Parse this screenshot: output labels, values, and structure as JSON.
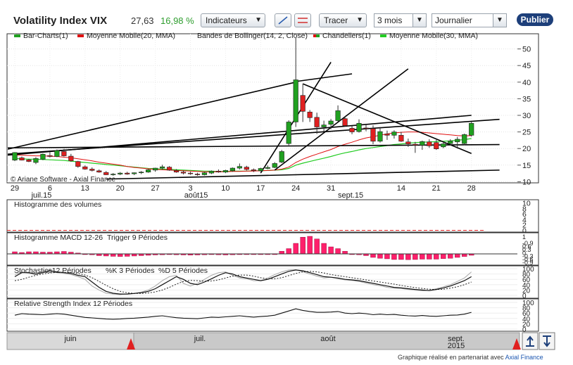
{
  "toolbar": {
    "title": "Volatility Index VIX",
    "price": "27,63",
    "change": "16,98 %",
    "indicators_label": "Indicateurs",
    "draw_label": "Tracer",
    "period_value": "3 mois",
    "frequency_value": "Journalier",
    "publish_label": "Publier",
    "dropdown_icon": "chevron-down-icon",
    "line_tool_icon": "diagonal-line-icon",
    "hline_tool_icon": "horizontal-lines-icon"
  },
  "footer": {
    "text": "Graphique réalisé en partenariat avec",
    "link": "Axial Finance"
  },
  "colors": {
    "up": "#20a020",
    "down": "#e02020",
    "ma20": "#e01010",
    "ma30": "#22cc22",
    "histogram": "#ff1f6b",
    "trend": "#000000",
    "navigator": "#d9d9d9",
    "accent": "#1d3f7a"
  },
  "chart_data": [
    {
      "type": "candlestick",
      "legend": [
        "Bar-Charts(1)",
        "Moyenne Mobile(20, MMA)",
        "Bandes de Bollinger(14, 2, Close)",
        "Chandeliers(1)",
        "Moyenne Mobile(30, MMA)"
      ],
      "watermark": "© Ariane Software - Axial Finance",
      "x_ticks": [
        {
          "label": "29",
          "i": 0
        },
        {
          "label": "6",
          "i": 5
        },
        {
          "label": "13",
          "i": 10
        },
        {
          "label": "20",
          "i": 15
        },
        {
          "label": "27",
          "i": 20
        },
        {
          "label": "3",
          "i": 25
        },
        {
          "label": "10",
          "i": 30
        },
        {
          "label": "17",
          "i": 35
        },
        {
          "label": "24",
          "i": 40
        },
        {
          "label": "31",
          "i": 45
        },
        {
          "label": "14",
          "i": 55
        },
        {
          "label": "21",
          "i": 60
        },
        {
          "label": "28",
          "i": 65
        }
      ],
      "month_labels": [
        {
          "label": "juil.15",
          "i": 2
        },
        {
          "label": "août15",
          "i": 24
        },
        {
          "label": "sept.15",
          "i": 46
        }
      ],
      "y_ticks": [
        10,
        15,
        20,
        25,
        30,
        35,
        40,
        45,
        50
      ],
      "ylim": [
        10,
        54
      ],
      "ohlc": [
        [
          16.5,
          18.9,
          16.2,
          18.8
        ],
        [
          17.2,
          17.6,
          16.4,
          16.5
        ],
        [
          16.6,
          16.9,
          15.9,
          16.1
        ],
        [
          15.8,
          17.4,
          15.3,
          17.0
        ],
        [
          16.8,
          18.5,
          16.5,
          18.3
        ],
        [
          17.9,
          18.9,
          17.3,
          17.6
        ],
        [
          17.6,
          19.7,
          17.4,
          19.4
        ],
        [
          19.1,
          19.9,
          17.6,
          17.8
        ],
        [
          17.7,
          18.4,
          16.0,
          16.3
        ],
        [
          16.1,
          16.3,
          14.2,
          14.6
        ],
        [
          14.5,
          14.9,
          13.6,
          13.8
        ],
        [
          13.8,
          14.3,
          13.1,
          13.4
        ],
        [
          13.3,
          13.7,
          12.7,
          12.9
        ],
        [
          12.8,
          13.2,
          12.0,
          12.1
        ],
        [
          12.2,
          12.6,
          11.8,
          12.3
        ],
        [
          12.3,
          12.9,
          12.0,
          12.6
        ],
        [
          12.6,
          13.0,
          12.1,
          12.3
        ],
        [
          12.4,
          12.8,
          12.0,
          12.7
        ],
        [
          12.7,
          13.2,
          12.3,
          12.9
        ],
        [
          12.9,
          13.8,
          12.7,
          13.6
        ],
        [
          13.5,
          14.2,
          13.0,
          14.1
        ],
        [
          14.1,
          15.1,
          13.6,
          14.5
        ],
        [
          14.4,
          14.7,
          13.3,
          13.5
        ],
        [
          13.4,
          13.8,
          12.7,
          12.9
        ],
        [
          12.9,
          13.3,
          12.2,
          12.6
        ],
        [
          12.6,
          13.0,
          12.1,
          12.4
        ],
        [
          12.3,
          12.7,
          11.8,
          12.1
        ],
        [
          12.1,
          12.9,
          11.9,
          12.7
        ],
        [
          12.6,
          13.4,
          12.3,
          13.2
        ],
        [
          13.2,
          13.7,
          12.7,
          12.9
        ],
        [
          12.9,
          13.6,
          12.6,
          13.4
        ],
        [
          13.3,
          14.3,
          13.0,
          14.1
        ],
        [
          14.1,
          15.5,
          13.7,
          14.6
        ],
        [
          14.4,
          14.8,
          13.4,
          13.7
        ],
        [
          13.6,
          14.0,
          12.9,
          13.3
        ],
        [
          13.3,
          14.2,
          13.1,
          14.0
        ],
        [
          14.0,
          14.9,
          13.8,
          14.3
        ],
        [
          14.3,
          15.9,
          14.1,
          15.5
        ],
        [
          15.9,
          19.6,
          15.6,
          19.1
        ],
        [
          21.5,
          28.5,
          21.0,
          28.0
        ],
        [
          28.0,
          53.3,
          26.5,
          40.7
        ],
        [
          36.0,
          39.5,
          28.0,
          31.2
        ],
        [
          31.0,
          31.6,
          28.0,
          29.3
        ],
        [
          29.4,
          30.8,
          24.4,
          26.5
        ],
        [
          26.5,
          28.4,
          25.2,
          27.1
        ],
        [
          27.3,
          28.9,
          25.8,
          28.3
        ],
        [
          28.4,
          33.0,
          28.2,
          31.4
        ],
        [
          29.0,
          29.8,
          26.6,
          26.9
        ],
        [
          26.1,
          26.8,
          24.3,
          25.0
        ],
        [
          25.1,
          28.8,
          24.8,
          27.6
        ],
        [
          26.2,
          27.1,
          25.2,
          26.0
        ],
        [
          26.0,
          27.0,
          21.3,
          22.2
        ],
        [
          22.2,
          26.5,
          21.8,
          25.1
        ],
        [
          24.4,
          25.4,
          22.6,
          24.0
        ],
        [
          24.0,
          25.5,
          23.0,
          25.0
        ],
        [
          24.0,
          25.0,
          22.0,
          22.2
        ],
        [
          22.0,
          23.0,
          20.5,
          21.4
        ],
        [
          21.3,
          22.0,
          18.7,
          21.0
        ],
        [
          21.0,
          22.4,
          19.6,
          22.1
        ],
        [
          22.0,
          22.8,
          20.2,
          20.8
        ],
        [
          21.8,
          22.6,
          19.6,
          19.9
        ],
        [
          20.5,
          22.0,
          20.1,
          21.4
        ],
        [
          21.5,
          22.8,
          20.9,
          22.3
        ],
        [
          22.0,
          23.5,
          20.0,
          22.8
        ],
        [
          21.5,
          24.5,
          21.0,
          24.2
        ],
        [
          24.0,
          28.0,
          23.6,
          27.6
        ]
      ],
      "ma20": [
        18.0,
        18.0,
        17.9,
        17.8,
        17.8,
        17.7,
        17.6,
        17.4,
        17.2,
        16.9,
        16.6,
        16.3,
        15.9,
        15.6,
        15.3,
        15.0,
        14.6,
        14.3,
        14.1,
        13.9,
        13.7,
        13.6,
        13.5,
        13.4,
        13.3,
        13.2,
        13.1,
        13.0,
        13.0,
        13.0,
        13.0,
        13.1,
        13.1,
        13.2,
        13.2,
        13.3,
        13.4,
        13.5,
        13.8,
        14.4,
        15.8,
        16.8,
        17.6,
        18.3,
        19.0,
        19.7,
        20.6,
        21.3,
        21.9,
        22.6,
        23.2,
        23.6,
        24.0,
        24.4,
        24.7,
        24.9,
        25.0,
        25.0,
        24.9,
        24.7,
        24.5,
        24.3,
        24.1,
        23.9,
        23.8,
        23.9
      ],
      "ma30": [
        17.0,
        16.9,
        16.8,
        16.8,
        16.7,
        16.6,
        16.5,
        16.4,
        16.2,
        16.0,
        15.8,
        15.6,
        15.4,
        15.2,
        15.0,
        14.8,
        14.6,
        14.4,
        14.2,
        14.0,
        13.9,
        13.8,
        13.7,
        13.6,
        13.5,
        13.4,
        13.3,
        13.2,
        13.2,
        13.1,
        13.1,
        13.2,
        13.2,
        13.2,
        13.3,
        13.3,
        13.4,
        13.5,
        13.6,
        14.0,
        15.0,
        15.6,
        16.1,
        16.6,
        17.1,
        17.6,
        18.2,
        18.7,
        19.1,
        19.6,
        20.0,
        20.3,
        20.6,
        20.9,
        21.2,
        21.4,
        21.6,
        21.8,
        21.9,
        22.0,
        22.1,
        22.2,
        22.3,
        22.5,
        22.7,
        23.0
      ],
      "trend_lines": [
        [
          [
            -1,
            19.8
          ],
          [
            40,
            40.0
          ]
        ],
        [
          [
            40,
            40.2
          ],
          [
            48,
            42.5
          ]
        ],
        [
          [
            -1,
            20.2
          ],
          [
            69,
            21.2
          ]
        ],
        [
          [
            -1,
            18.3
          ],
          [
            69,
            28.8
          ]
        ],
        [
          [
            13,
            10.8
          ],
          [
            69,
            13.5
          ]
        ],
        [
          [
            35,
            12.6
          ],
          [
            45,
            46.0
          ]
        ],
        [
          [
            37,
            13.5
          ],
          [
            56,
            44.0
          ]
        ],
        [
          [
            41,
            39.5
          ],
          [
            65,
            18.5
          ]
        ],
        [
          [
            -1,
            18.0
          ],
          [
            65,
            30.0
          ]
        ]
      ]
    },
    {
      "type": "bar",
      "title": "Histogramme des volumes",
      "y_ticks": [
        0,
        2,
        4,
        6,
        8,
        10
      ],
      "ylim": [
        0,
        10
      ],
      "values": []
    },
    {
      "type": "bar",
      "title": "Histogramme MACD 12-26",
      "subtitle": "Trigger 9 Périodes",
      "y_ticks": [
        -0.9,
        -0.6,
        -0.3,
        0,
        0.3,
        0.6,
        0.9
      ],
      "y_tick_labels": [
        "-0.9",
        "-0.6",
        "-0.3",
        "0",
        "0.3",
        "0.6",
        "-0.9"
      ],
      "top_label": "1",
      "ylim": [
        -1.1,
        1.1
      ],
      "values": [
        0.12,
        0.08,
        0.12,
        0.12,
        0.1,
        0.1,
        0.12,
        0.14,
        0.1,
        0.05,
        0.0,
        -0.05,
        -0.1,
        -0.12,
        -0.14,
        -0.15,
        -0.14,
        -0.12,
        -0.1,
        -0.08,
        -0.06,
        -0.05,
        -0.04,
        -0.05,
        -0.06,
        -0.07,
        -0.06,
        -0.05,
        -0.04,
        -0.05,
        -0.06,
        -0.05,
        -0.04,
        -0.03,
        -0.03,
        -0.03,
        -0.02,
        0.0,
        0.15,
        0.3,
        0.6,
        0.95,
        1.0,
        0.85,
        0.6,
        0.4,
        0.3,
        0.15,
        0.0,
        -0.05,
        -0.1,
        -0.2,
        -0.25,
        -0.28,
        -0.32,
        -0.32,
        -0.33,
        -0.32,
        -0.3,
        -0.3,
        -0.3,
        -0.27,
        -0.25,
        -0.2,
        -0.15,
        -0.08
      ]
    },
    {
      "type": "line",
      "title": "Stochastics12 Périodes",
      "series_labels": [
        "%K 3 Périodes",
        "%D 5 Périodes"
      ],
      "y_ticks": [
        0,
        20,
        40,
        60,
        80,
        100
      ],
      "ylim": [
        0,
        100
      ],
      "k": [
        70,
        85,
        85,
        80,
        85,
        92,
        88,
        85,
        82,
        75,
        70,
        50,
        30,
        15,
        8,
        5,
        5,
        7,
        10,
        15,
        25,
        40,
        55,
        70,
        60,
        45,
        40,
        50,
        62,
        75,
        85,
        80,
        70,
        65,
        60,
        55,
        60,
        70,
        80,
        90,
        95,
        92,
        85,
        78,
        70,
        68,
        65,
        60,
        58,
        55,
        50,
        45,
        40,
        35,
        30,
        28,
        25,
        22,
        20,
        18,
        22,
        28,
        35,
        45,
        55,
        70
      ],
      "d": [
        55,
        60,
        68,
        75,
        80,
        84,
        86,
        86,
        85,
        82,
        76,
        66,
        52,
        38,
        25,
        15,
        10,
        7,
        7,
        9,
        13,
        20,
        30,
        42,
        52,
        56,
        55,
        53,
        54,
        58,
        65,
        72,
        76,
        76,
        72,
        66,
        62,
        62,
        66,
        74,
        82,
        88,
        90,
        88,
        84,
        78,
        74,
        70,
        66,
        62,
        58,
        54,
        50,
        46,
        42,
        37,
        33,
        29,
        26,
        23,
        22,
        23,
        27,
        32,
        40,
        50
      ],
      "raw": [
        78,
        88,
        82,
        78,
        90,
        95,
        85,
        82,
        78,
        70,
        60,
        35,
        20,
        8,
        5,
        3,
        6,
        8,
        12,
        20,
        35,
        55,
        70,
        75,
        45,
        35,
        45,
        60,
        75,
        85,
        88,
        75,
        65,
        62,
        55,
        55,
        65,
        78,
        88,
        95,
        96,
        88,
        80,
        72,
        65,
        68,
        62,
        58,
        56,
        52,
        46,
        40,
        36,
        30,
        27,
        26,
        22,
        20,
        17,
        19,
        25,
        32,
        40,
        52,
        65,
        88
      ]
    },
    {
      "type": "line",
      "title": "Relative Strength Index 12 Périodes",
      "y_ticks": [
        0,
        20,
        40,
        60,
        80,
        100
      ],
      "ylim": [
        0,
        100
      ],
      "values": [
        52,
        58,
        56,
        55,
        54,
        56,
        58,
        56,
        52,
        48,
        44,
        42,
        40,
        38,
        37,
        38,
        40,
        41,
        43,
        45,
        48,
        50,
        46,
        43,
        41,
        40,
        39,
        42,
        45,
        44,
        46,
        48,
        50,
        47,
        45,
        47,
        49,
        52,
        60,
        68,
        76,
        70,
        66,
        63,
        63,
        64,
        66,
        60,
        58,
        60,
        58,
        54,
        56,
        54,
        55,
        52,
        50,
        49,
        51,
        49,
        48,
        50,
        52,
        53,
        56,
        63
      ]
    },
    {
      "type": "navigator",
      "labels": [
        {
          "label": "juin",
          "x": 100
        },
        {
          "label": "juil.",
          "x": 284
        },
        {
          "label": "août",
          "x": 466
        },
        {
          "label": "sept.",
          "x": 648
        },
        {
          "label": "2015",
          "x": 648
        }
      ]
    }
  ]
}
